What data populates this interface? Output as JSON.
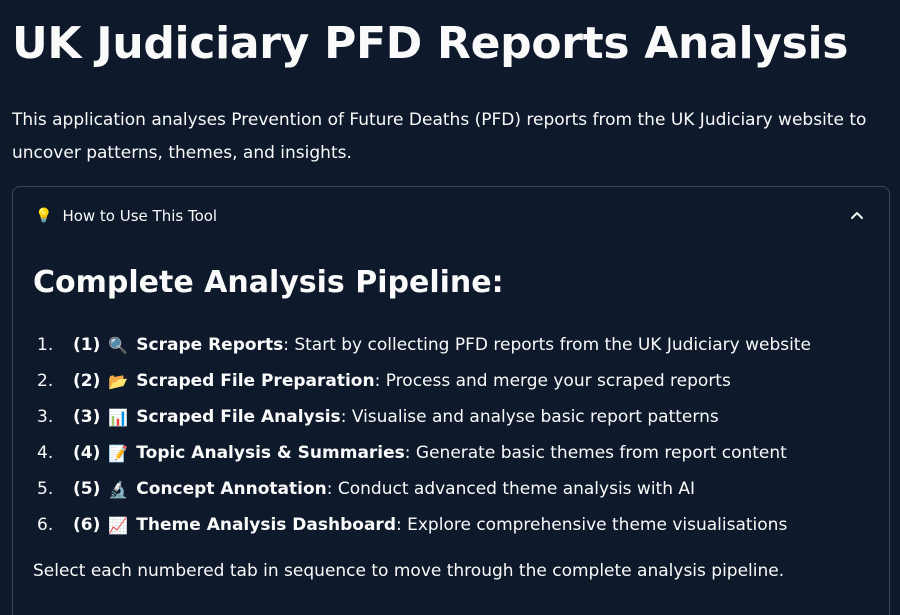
{
  "page": {
    "title": "UK Judiciary PFD Reports Analysis",
    "intro": "This application analyses Prevention of Future Deaths (PFD) reports from the UK Judiciary website to uncover patterns, themes, and insights."
  },
  "expander": {
    "icon": "lightbulb-icon",
    "icon_glyph": "💡",
    "title": "How to Use This Tool",
    "expanded": true,
    "heading": "Complete Analysis Pipeline:",
    "steps": [
      {
        "num": "1.",
        "tab": "(1)",
        "emoji": "🔍",
        "icon": "magnifier-icon",
        "name": "Scrape Reports",
        "desc": ": Start by collecting PFD reports from the UK Judiciary website"
      },
      {
        "num": "2.",
        "tab": "(2)",
        "emoji": "📂",
        "icon": "folder-icon",
        "name": "Scraped File Preparation",
        "desc": ": Process and merge your scraped reports"
      },
      {
        "num": "3.",
        "tab": "(3)",
        "emoji": "📊",
        "icon": "bar-chart-icon",
        "name": "Scraped File Analysis",
        "desc": ": Visualise and analyse basic report patterns"
      },
      {
        "num": "4.",
        "tab": "(4)",
        "emoji": "📝",
        "icon": "memo-icon",
        "name": "Topic Analysis & Summaries",
        "desc": ": Generate basic themes from report content"
      },
      {
        "num": "5.",
        "tab": "(5)",
        "emoji": "🔬",
        "icon": "microscope-icon",
        "name": "Concept Annotation",
        "desc": ": Conduct advanced theme analysis with AI"
      },
      {
        "num": "6.",
        "tab": "(6)",
        "emoji": "📈",
        "icon": "trending-chart-icon",
        "name": "Theme Analysis Dashboard",
        "desc": ": Explore comprehensive theme visualisations"
      }
    ],
    "closing": "Select each numbered tab in sequence to move through the complete analysis pipeline."
  },
  "colors": {
    "background": "#0e1a2b",
    "text": "#fafafa",
    "border": "#3b4556"
  }
}
